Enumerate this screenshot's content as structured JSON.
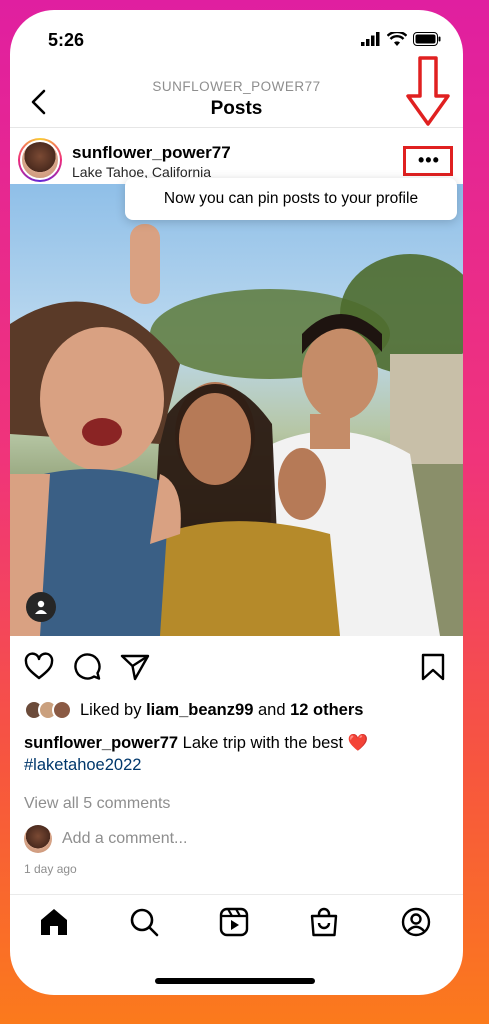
{
  "status_bar": {
    "time": "5:26"
  },
  "header": {
    "username_caps": "SUNFLOWER_POWER77",
    "title": "Posts"
  },
  "post": {
    "username": "sunflower_power77",
    "location": "Lake Tahoe, California",
    "more_label": "•••",
    "tooltip": "Now you can pin posts to your profile",
    "liked_prefix": "Liked by",
    "liked_user": "liam_beanz99",
    "liked_and": "and",
    "liked_others": "12 others",
    "caption_user": "sunflower_power77",
    "caption_text": "Lake trip with the best",
    "caption_emoji": "❤️",
    "hashtag": "#laketahoe2022",
    "view_comments": "View all 5 comments",
    "add_comment_placeholder": "Add a comment...",
    "time_ago": "1 day ago"
  },
  "colors": {
    "highlight_red": "#e02020",
    "hashtag_blue": "#00376b",
    "muted_gray": "#8e8e8e"
  },
  "icons": {
    "back": "chevron-left-icon",
    "more": "ellipsis-icon",
    "annotation_arrow": "down-arrow-icon",
    "tag": "person-tag-icon",
    "like": "heart-icon",
    "comment": "comment-bubble-icon",
    "share": "paper-plane-icon",
    "save": "bookmark-icon",
    "home": "home-icon",
    "search": "search-icon",
    "reels": "reels-icon",
    "shop": "shopping-bag-icon",
    "profile": "profile-icon"
  }
}
